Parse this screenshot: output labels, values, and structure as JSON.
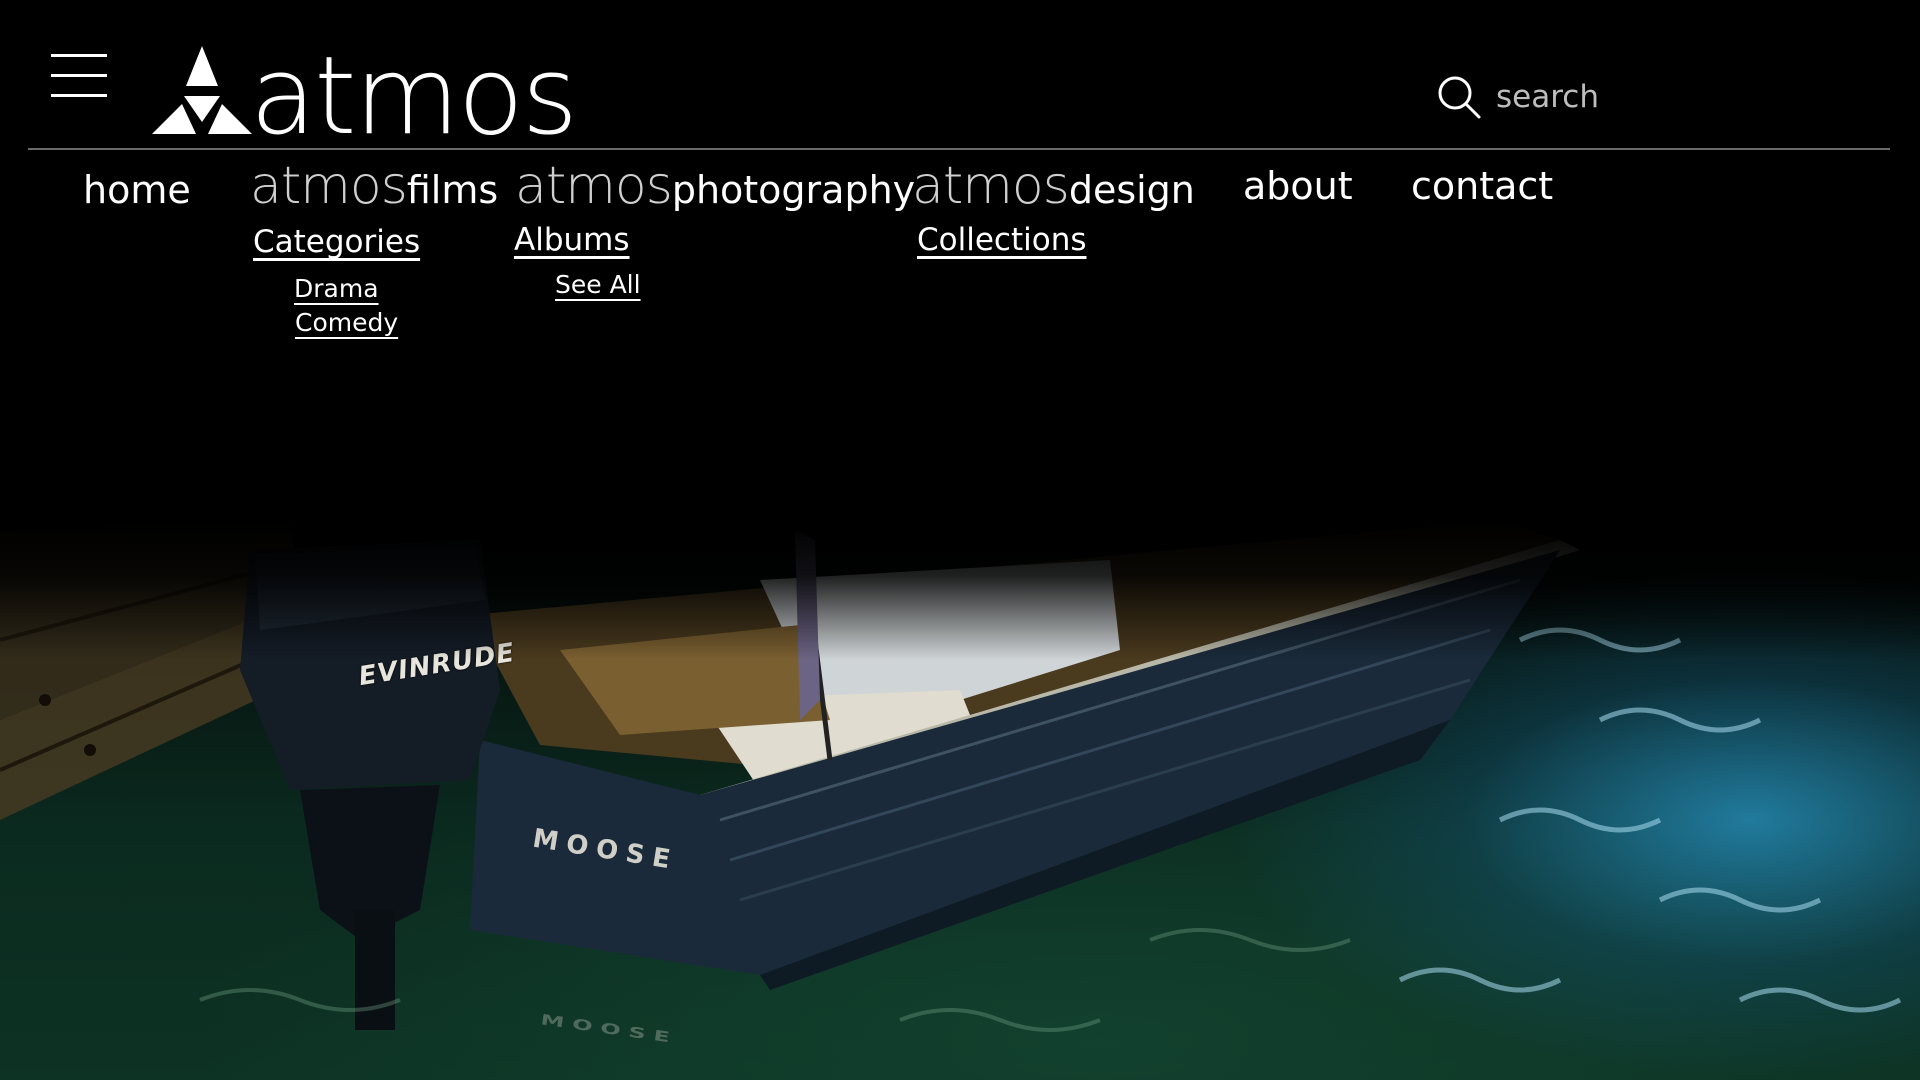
{
  "brand": {
    "logo_text": "atmos"
  },
  "header": {
    "menu_icon": "hamburger-menu-icon",
    "search": {
      "icon": "search-icon",
      "placeholder": "search",
      "value": ""
    }
  },
  "nav": {
    "home": "home",
    "films": {
      "prefix": "atmos",
      "suffix": "films"
    },
    "photography": {
      "prefix": "atmos",
      "suffix": "photography"
    },
    "design": {
      "prefix": "atmos",
      "suffix": "design"
    },
    "about": "about",
    "contact": "contact"
  },
  "submenus": {
    "films": {
      "heading": "Categories",
      "items": [
        "Drama",
        "Comedy"
      ]
    },
    "photography": {
      "heading": "Albums",
      "items": [
        "See All"
      ]
    },
    "design": {
      "heading": "Collections"
    }
  },
  "hero": {
    "motor_brand": "EVINRUDE",
    "boat_name": "MOOSE"
  },
  "colors": {
    "background": "#000000",
    "text": "#ffffff",
    "muted": "#cfcfcf",
    "rule": "#6a6a6a",
    "water_blue": "#2896c8",
    "water_green": "#0d3324"
  }
}
